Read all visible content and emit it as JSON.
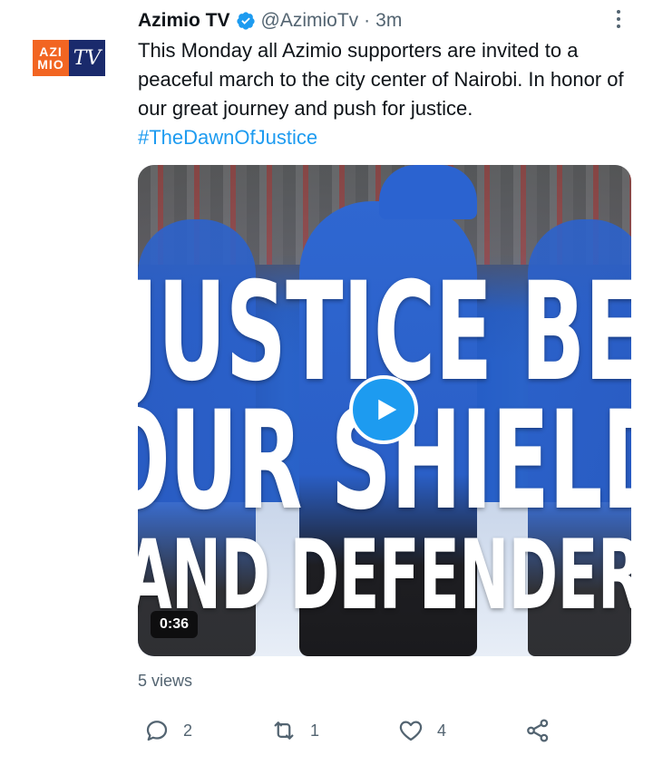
{
  "account": {
    "avatar_text_top": "AZI",
    "avatar_text_bottom": "MIO",
    "avatar_text_right": "TV",
    "name": "Azimio TV",
    "handle": "@AzimioTv",
    "separator": "·",
    "time": "3m",
    "verified_icon": "verified-badge-icon"
  },
  "tweet": {
    "text": "This Monday all Azimio supporters are invited to a peaceful march to the city center of Nairobi. In honor of our great journey and push for justice.",
    "hashtag": "#TheDawnOfJustice"
  },
  "media": {
    "overlay_line1": "JUSTICE BE",
    "overlay_line2": "OUR SHIELD",
    "overlay_line3": "AND DEFENDER",
    "duration": "0:36",
    "play_icon": "play-icon"
  },
  "stats": {
    "views": "5 views"
  },
  "actions": {
    "reply_count": "2",
    "retweet_count": "1",
    "like_count": "4"
  },
  "colors": {
    "accent": "#1d9bf0",
    "muted": "#536471",
    "text": "#0f1419"
  }
}
